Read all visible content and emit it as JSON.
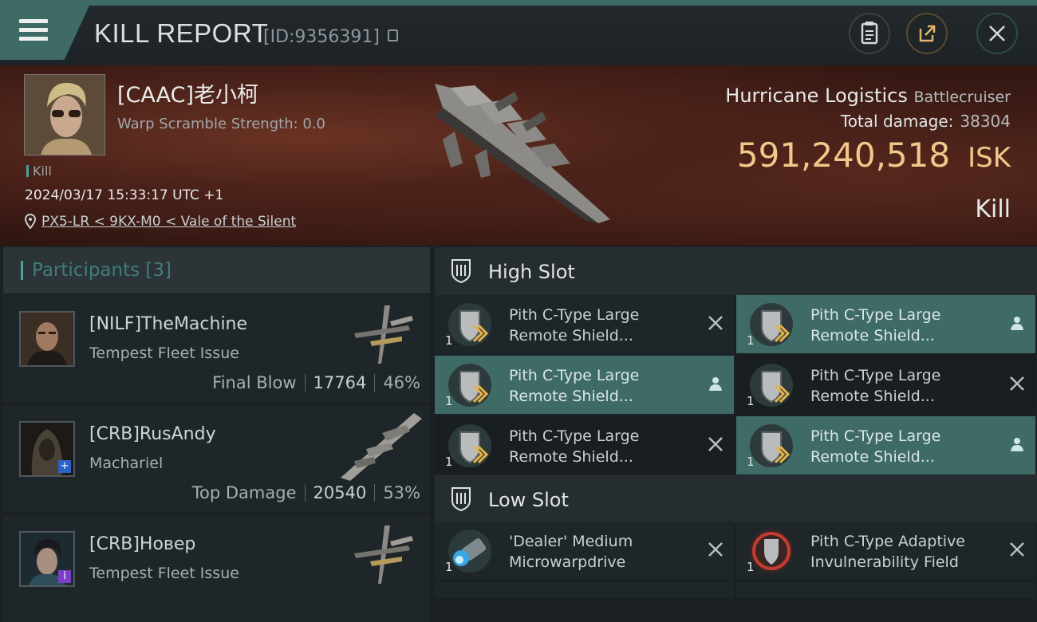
{
  "header": {
    "title": "KILL REPORT",
    "report_id": "[ID:9356391]"
  },
  "victim": {
    "name": "[CAAC]老小柯",
    "warp_scramble": "Warp Scramble Strength: 0.0",
    "kill_tag": "Kill",
    "datetime": "2024/03/17 15:33:17 UTC +1",
    "location": "PX5-LR < 9KX-M0 < Vale of the Silent",
    "ship_name": "Hurricane Logistics",
    "ship_class": "Battlecruiser",
    "total_damage_label": "Total damage:",
    "total_damage": "38304",
    "isk_value": "591,240,518",
    "isk_unit": "ISK",
    "result": "Kill"
  },
  "participants": {
    "title": "Participants [3]",
    "items": [
      {
        "name": "[NILF]TheMachine",
        "ship": "Tempest Fleet Issue",
        "role": "Final Blow",
        "damage": "17764",
        "percent": "46%"
      },
      {
        "name": "[CRB]RusAndy",
        "ship": "Machariel",
        "role": "Top Damage",
        "damage": "20540",
        "percent": "53%"
      },
      {
        "name": "[CRB]Новер",
        "ship": "Tempest Fleet Issue",
        "role": "",
        "damage": "",
        "percent": ""
      }
    ]
  },
  "high_slot": {
    "title": "High Slot",
    "modules": [
      {
        "line1": "Pith C-Type Large",
        "line2": "Remote Shield...",
        "qty": "1"
      },
      {
        "line1": "Pith C-Type Large",
        "line2": "Remote Shield...",
        "qty": "1"
      },
      {
        "line1": "Pith C-Type Large",
        "line2": "Remote Shield...",
        "qty": "1"
      },
      {
        "line1": "Pith C-Type Large",
        "line2": "Remote Shield...",
        "qty": "1"
      },
      {
        "line1": "Pith C-Type Large",
        "line2": "Remote Shield...",
        "qty": "1"
      },
      {
        "line1": "Pith C-Type Large",
        "line2": "Remote Shield...",
        "qty": "1"
      }
    ]
  },
  "low_slot": {
    "title": "Low Slot",
    "modules": [
      {
        "line1": "'Dealer' Medium",
        "line2": "Microwarpdrive",
        "qty": "1"
      },
      {
        "line1": "Pith C-Type Adaptive",
        "line2": "Invulnerability Field",
        "qty": "1"
      }
    ]
  },
  "colors": {
    "accent": "#3f6b67",
    "isk": "#f1c88a",
    "banner": "#4b2219"
  },
  "icons": [
    "menu-icon",
    "clipboard-icon",
    "share-icon",
    "close-icon",
    "copy-icon",
    "location-pin-icon",
    "slot-shield-icon",
    "remove-x-icon",
    "person-icon",
    "shield-module-icon",
    "microwarpdrive-icon"
  ]
}
